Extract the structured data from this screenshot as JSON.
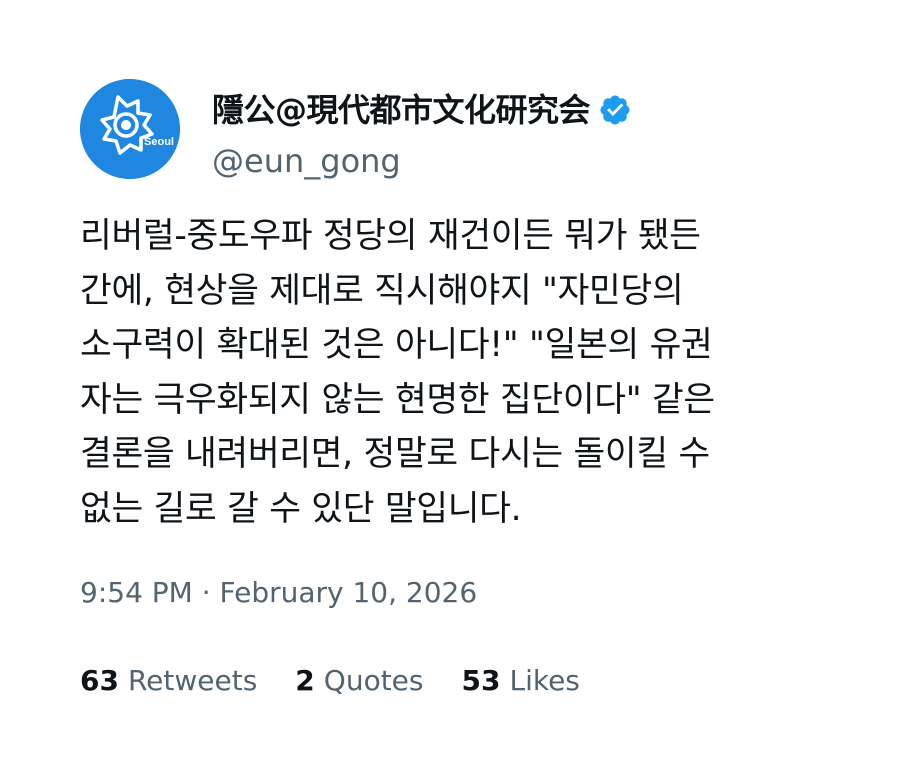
{
  "author": {
    "display_name": "隱公@現代都市文化研究会",
    "handle": "@eun_gong",
    "avatar_text": "Seoul",
    "verified": true,
    "avatar_color": "#1f87e0",
    "verified_color": "#1d9bf0"
  },
  "tweet": {
    "lines": [
      "리버럴-중도우파 정당의 재건이든 뭐가 됐든",
      "간에, 현상을 제대로 직시해야지 \"자민당의",
      "소구력이 확대된 것은 아니다!\" \"일본의 유권",
      "자는 극우화되지 않는 현명한 집단이다\" 같은",
      "결론을 내려버리면, 정말로 다시는 돌이킬 수",
      "없는 길로 갈 수 있단 말입니다."
    ],
    "timestamp": "9:54 PM · February 10, 2026"
  },
  "stats": [
    {
      "count": "63",
      "label": "Retweets"
    },
    {
      "count": "2",
      "label": "Quotes"
    },
    {
      "count": "53",
      "label": "Likes"
    }
  ]
}
